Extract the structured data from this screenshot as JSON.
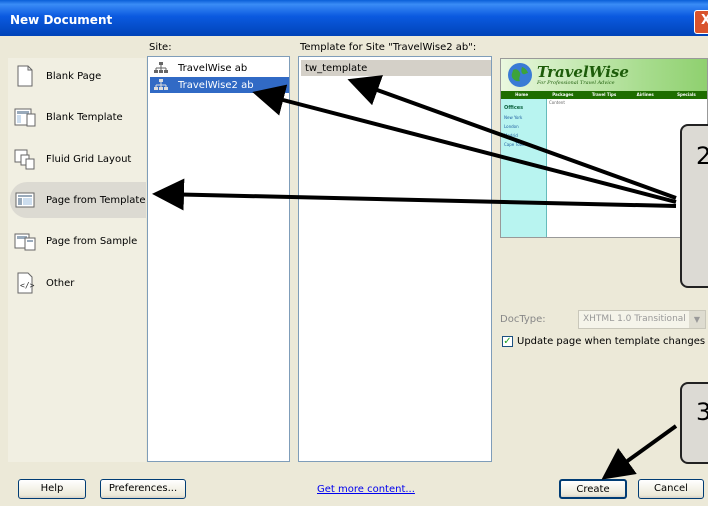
{
  "window": {
    "title": "New Document",
    "close_glyph": "X"
  },
  "categories": [
    {
      "label": "Blank Page",
      "icon": "blank-page-icon"
    },
    {
      "label": "Blank Template",
      "icon": "blank-template-icon"
    },
    {
      "label": "Fluid Grid Layout",
      "icon": "fluid-grid-icon"
    },
    {
      "label": "Page from Template",
      "icon": "page-template-icon",
      "selected": true
    },
    {
      "label": "Page from Sample",
      "icon": "page-sample-icon"
    },
    {
      "label": "Other",
      "icon": "other-icon"
    }
  ],
  "site": {
    "label": "Site:",
    "items": [
      {
        "label": "TravelWise ab",
        "icon": "site-icon"
      },
      {
        "label": "TravelWise2 ab",
        "icon": "site-icon",
        "selected": true
      }
    ]
  },
  "template": {
    "label": "Template for Site \"TravelWise2 ab\":",
    "items": [
      {
        "label": "tw_template",
        "selected": true
      }
    ]
  },
  "preview": {
    "logo": "TravelWise",
    "tagline": "For Professional Travel Advice",
    "nav": [
      "Home",
      "Packages",
      "Travel Tips",
      "Airlines",
      "Specials"
    ],
    "sidebar_heading": "Offices",
    "sidebar_links": [
      "New York",
      "London",
      "Madrid",
      "Cape Town"
    ],
    "content_label": "Content"
  },
  "doctype": {
    "label": "DocType:",
    "value": "XHTML 1.0 Transitional"
  },
  "update_checkbox": {
    "label": "Update page when template changes",
    "checked": true
  },
  "buttons": {
    "help": "Help",
    "preferences": "Preferences...",
    "create": "Create",
    "cancel": "Cancel"
  },
  "link": "Get more content...",
  "callouts": [
    "2",
    "3"
  ],
  "colors": {
    "selection": "#316ac5",
    "titlebar": "#0a5fd8"
  }
}
